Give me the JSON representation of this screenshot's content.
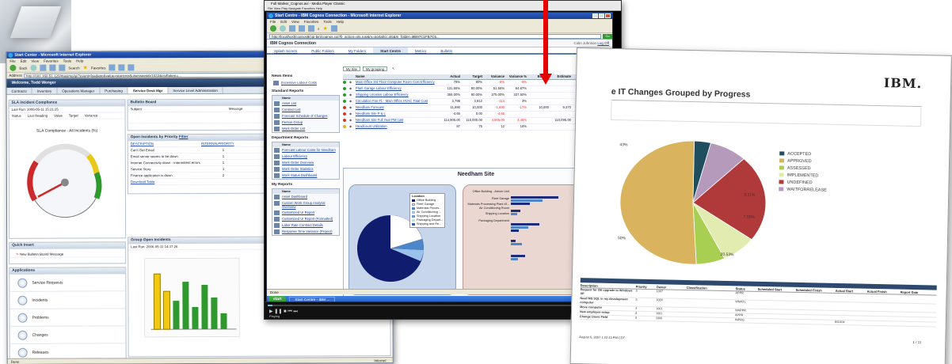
{
  "photo": {
    "caption": ""
  },
  "w1": {
    "title": "Start Center - Microsoft Internet Explorer",
    "menu": [
      "File",
      "Edit",
      "View",
      "Favorites",
      "Tools",
      "Help"
    ],
    "toolbar": {
      "back": "Back",
      "search": "Search",
      "favorites": "Favorites"
    },
    "address": {
      "label": "Address",
      "url": "http://181.160.51.120/maximo/ui/?event=loadapp&value=startcntr&uisessionid=1022&csrftoken=...",
      "go": "Go"
    },
    "brand": "Welcome, Todd Wenger",
    "tabs": [
      "Contracts",
      "Inventory",
      "Operations Manager",
      "Purchasing",
      "Service Desk Mgr",
      "Service Level Administration"
    ],
    "sla": {
      "title": "SLA Incident Compliance",
      "last_run": "Last Run: 2006-05-11 15:21:25",
      "chart_title": "SLA Compliance - All Incidents (%)",
      "cols": [
        "Status",
        "Last Reading",
        "Value",
        "Target",
        "Variance"
      ],
      "gauge_ticks": [
        "0",
        "10",
        "20",
        "30",
        "40",
        "50",
        "60",
        "70",
        "80",
        "90",
        "100"
      ]
    },
    "bulletin": {
      "title": "Bulletin Board",
      "cols": [
        "Subject",
        "Message"
      ],
      "empty": "There are currently no bulletin board messages."
    },
    "open_inc": {
      "title": "Open Incidents by Priority",
      "filter": "Filter",
      "cols": [
        "DESCRIPTION",
        "INTERNALPRIORITY"
      ],
      "rows": [
        [
          "Can't Get Email",
          "1"
        ],
        [
          "Email server seems to be down",
          "1"
        ],
        [
          "Internet Connectivity down - intermittent errors",
          "1"
        ],
        [
          "Service Story",
          "1"
        ],
        [
          "Finance application is down",
          "2"
        ]
      ],
      "more": "Download Table"
    },
    "quick": {
      "title": "Quick Insert",
      "item": "New Bulletin Board Message"
    },
    "apps": {
      "title": "Applications",
      "items": [
        "Service Requests",
        "Incidents",
        "Problems",
        "Changes",
        "Releases"
      ]
    },
    "group": {
      "title": "Group Open Incidents",
      "last_run": "Last Run: 2006-05-11 14:37:26",
      "status_label": "Status",
      "status_items": [
        "Esse",
        "ERR",
        "Face",
        "Netw",
        "OPS",
        "Ops",
        "EMEI",
        "Netwo"
      ]
    },
    "status_left": "Done",
    "status_right": "Internet"
  },
  "w2": {
    "player_title": "Full Marker_Cognos.avi - Media Player Classic",
    "player_menu": [
      "File",
      "View",
      "Play",
      "Navigate",
      "Favorites",
      "Help"
    ],
    "title": "Start Centre - IBM Cognos Connection - Microsoft Internet Explorer",
    "menu": [
      "File",
      "Edit",
      "View",
      "Favorites",
      "Tools",
      "Help"
    ],
    "address": "http://localhost/cognos8/cgi-bin/cognos.cgi?b_action=xts.run&m=portal/cc.xts&m_folder=i8B97C1FB7C5...",
    "go": "Go",
    "app_title": "IBM Cognos Connection",
    "user": "Colin Johnson",
    "logoff": "Log Off",
    "tabs": [
      "Splash Screen",
      "Public Folders",
      "My Folders",
      "Start Centre",
      "Metrics",
      "Bulletin"
    ],
    "news": {
      "title": "News Items",
      "item": "Excessive Labour Costs"
    },
    "std": {
      "title": "Standard Reports",
      "header": "Name",
      "items": [
        "Asset List",
        "Contract List",
        "Forecast Schedule of Changes",
        "Person Group",
        "Work Order List"
      ]
    },
    "dept": {
      "title": "Department Reports",
      "header": "Name",
      "items": [
        "Forecast Labour Costs for Needham",
        "Labour Efficiency",
        "Work Order Overview",
        "Work Order Statistics",
        "Work Status Dashboard"
      ]
    },
    "my": {
      "title": "My Reports",
      "header": "Name",
      "items": [
        "Asset Dashboard",
        "Custom Work Group Analysis Overview",
        "Customized UI Report",
        "Customized UI Report (Formatted)",
        "Labor Rate Contract Details",
        "Response Time Variance (Project)"
      ]
    },
    "ctrl": [
      "My Site",
      "My grouping"
    ],
    "metrics_count": "[Metrics 1-8]",
    "cols": [
      "Name",
      "Actual",
      "Target",
      "Variance",
      "Variance %",
      "Budget",
      "Estimate",
      "Time Period"
    ],
    "rows": [
      [
        "#2a9d2a",
        "Main Office 3rd Floor Computer Room Cost Efficiency",
        "79%",
        "80%",
        "-9%",
        "-6%",
        "",
        "",
        "Apr 2009"
      ],
      [
        "#2a9d2a",
        "Plant Garage Labour Efficiency",
        "131.55%",
        "80.00%",
        "51.55%",
        "64.67%",
        "",
        "",
        "Apr 2009"
      ],
      [
        "#2a9d2a",
        "Shipping Location Labour Efficiency",
        "355.00%",
        "80.00%",
        "275.00%",
        "337.50%",
        "",
        "",
        "Apr 2009"
      ],
      [
        "#2a9d2a",
        "Circulation Fan #1 - Main Office HVAC Total Cost",
        "3,798",
        "3,912",
        "-114",
        "3%",
        "",
        "",
        "Apr 2009"
      ],
      [
        "#d43a2a",
        "Needham Forecast",
        "11,690",
        "10,000",
        "-1,690",
        "-17%",
        "10,000",
        "9,370",
        "Apr 2009"
      ],
      [
        "#d43a2a",
        "Needham Site P & L",
        "-4.66",
        "0.00",
        "-4.66",
        "",
        "",
        "",
        "Apr 2009"
      ],
      [
        "#d43a2a",
        "Needham Site Full Year PM cost",
        "114,905.00",
        "110,000.00",
        "4,905.00",
        "4.46%",
        "",
        "110,095.00",
        "Apr 2009"
      ],
      [
        "#e0b020",
        "Headcount Utilization",
        "87",
        "75",
        "12",
        "16%",
        "",
        "",
        "Apr 2009"
      ]
    ],
    "map": {
      "title": "Needham Site",
      "loc_title": "Location",
      "loc_items": [
        "Office Building -",
        "Fleet Garage",
        "Materials Proces...",
        "Air Conditioning ...",
        "Shipping Location",
        "Packaging Depart...",
        "Shipping and Re..."
      ],
      "bar_labels": [
        "Office Building - Atrium Unit",
        "Fleet Garage",
        "Materials Processing Plant #1 - Air Conditioning Room",
        "Shipping Location",
        "Packaging Department"
      ],
      "year_title": "Year",
      "years": [
        "2009",
        "2007",
        "2008",
        "2006"
      ]
    },
    "status_left": "Done",
    "status_right": "Local intranet",
    "taskbar": {
      "start": "start",
      "item": "Start Centre - IBM ...",
      "clock": "1:36 PM"
    },
    "player_state": "Playing",
    "player_time": "00:01:17 / 00:02:55"
  },
  "w3": {
    "logo": "IBM.",
    "title": "e IT Changes Grouped by Progress",
    "chart_data": {
      "type": "pie",
      "title": "e IT Changes Grouped by Progress",
      "categories": [
        "ACCEPTED",
        "APPROVED",
        "ASSESSED",
        "IMPLEMENTED",
        "UNDEFINED",
        "WAITFORRELEASE"
      ],
      "values": [
        3.31,
        46.0,
        5.79,
        7.0,
        20.53,
        7.55
      ],
      "colors": [
        "#1f4e5f",
        "#d9b35e",
        "#a8cf52",
        "#e3ecb0",
        "#b03a3a",
        "#b59abb"
      ],
      "labels": [
        "3.31%",
        "43%",
        "7.55%",
        "20.53%",
        "50%"
      ]
    },
    "cols": [
      "Description",
      "Priority",
      "Owner",
      "Classification",
      "Status",
      "Scheduled Start",
      "Scheduled Finish",
      "Actual Start",
      "Actual Finish",
      "Report Date"
    ],
    "rows": [
      [
        "Request for OS upgrade to Windows XP",
        "3",
        "1007",
        "",
        "APPR",
        "",
        "",
        "",
        "",
        ""
      ],
      [
        "Need MS SQL in my development computer",
        "3",
        "1000",
        "",
        "WMATL",
        "",
        "",
        "",
        "",
        ""
      ],
      [
        "Move computer",
        "3",
        "1001",
        "",
        "WAPPR",
        "",
        "",
        "",
        "",
        ""
      ],
      [
        "New employee setup",
        "3",
        "1001",
        "",
        "APPR",
        "",
        "",
        "",
        "",
        ""
      ],
      [
        "Change Users Field",
        "3",
        "1000",
        "",
        "INPRG",
        "",
        "",
        "8/31/04",
        "",
        ""
      ]
    ],
    "footer": "August 6, 2007 1:22:43 PM CDT",
    "page": "1 / 11"
  }
}
